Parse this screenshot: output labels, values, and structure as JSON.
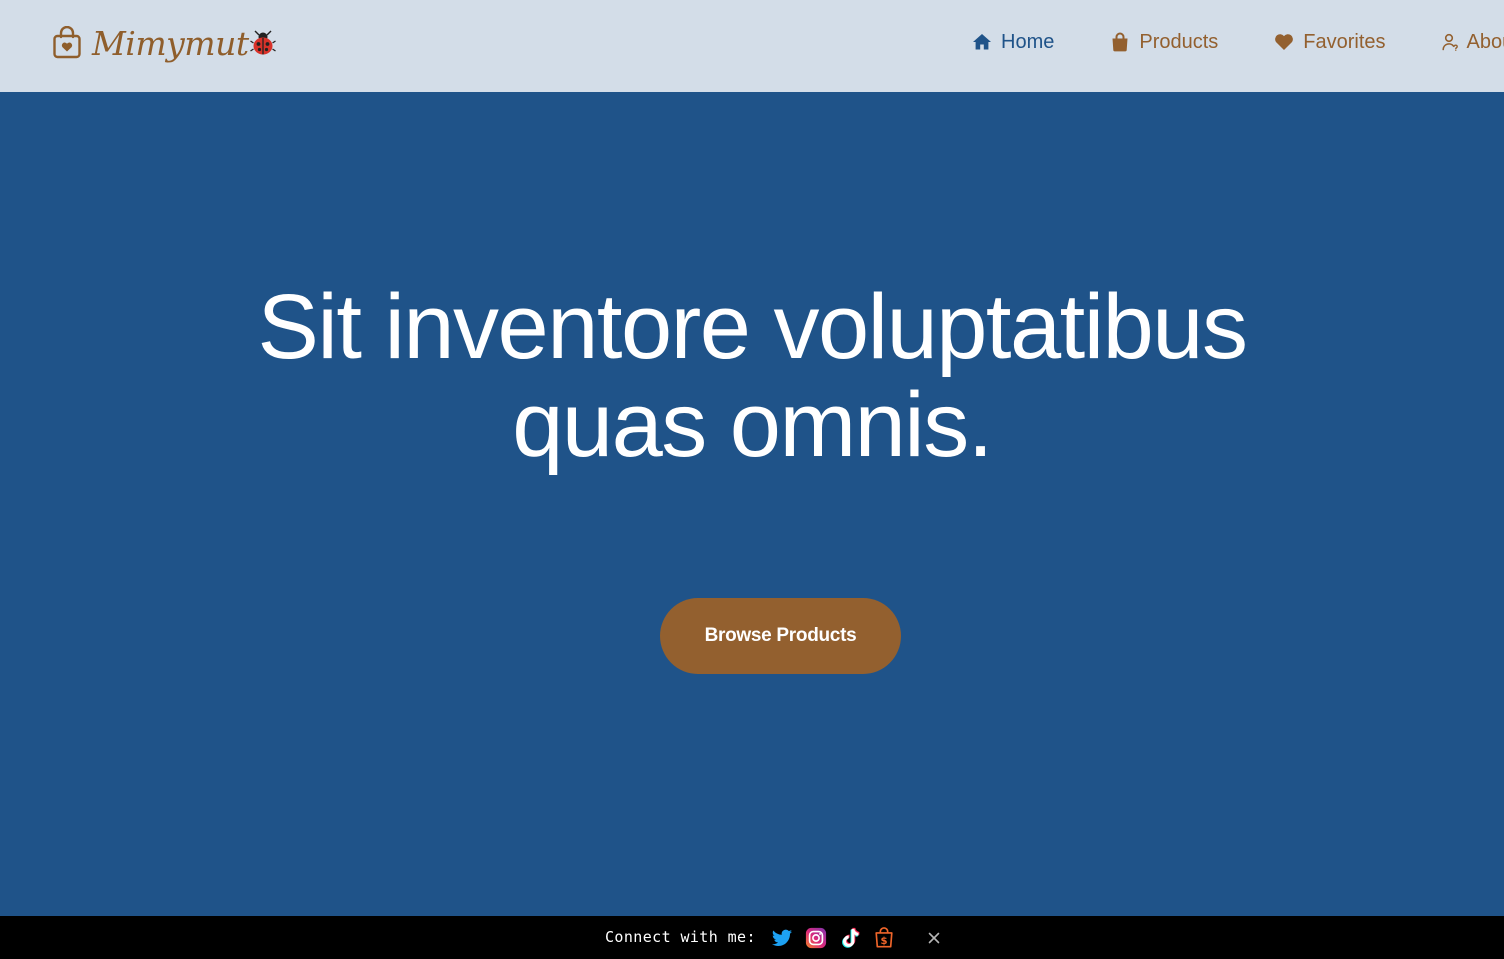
{
  "brand": {
    "name": "Mimymut",
    "bag_icon": "shopping-bag-heart-icon",
    "mascot_icon": "ladybug-icon",
    "color": "#8f5e2c"
  },
  "nav": {
    "items": [
      {
        "label": "Home",
        "icon": "home-icon",
        "active": true
      },
      {
        "label": "Products",
        "icon": "shopping-bag-icon",
        "active": false
      },
      {
        "label": "Favorites",
        "icon": "heart-icon",
        "active": false
      },
      {
        "label": "About",
        "icon": "user-icon",
        "active": false
      }
    ]
  },
  "hero": {
    "title_line1": "Sit inventore voluptatibus",
    "title_line2": "quas omnis.",
    "cta_label": "Browse Products",
    "background": "#1f5389",
    "cta_color": "#93602f"
  },
  "footer_bar": {
    "label": "Connect with me:",
    "socials": [
      {
        "name": "twitter-icon"
      },
      {
        "name": "instagram-icon"
      },
      {
        "name": "tiktok-icon"
      },
      {
        "name": "shopify-icon"
      }
    ],
    "close_icon": "close-icon"
  },
  "colors": {
    "header_bg": "#d3dde8",
    "accent_blue": "#1f5389",
    "accent_brown": "#93602f"
  }
}
